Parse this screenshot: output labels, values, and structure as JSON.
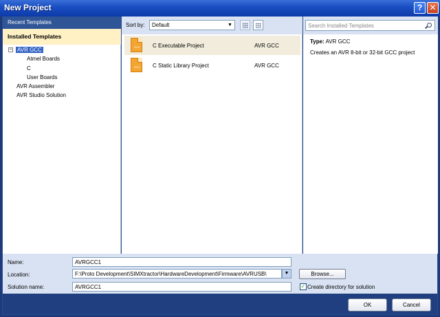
{
  "window": {
    "title": "New Project"
  },
  "left_panel": {
    "recent_label": "Recent Templates",
    "installed_label": "Installed Templates",
    "tree": [
      "AVR GCC",
      "Atmel Boards",
      "C",
      "User Boards",
      "AVR Assembler",
      "AVR Studio Solution"
    ]
  },
  "toolbar": {
    "sort_label": "Sort by:",
    "sort_value": "Default",
    "search_placeholder": "Search Installed Templates"
  },
  "templates": [
    {
      "icon_label": "GCC",
      "name": "C Executable Project",
      "type": "AVR GCC"
    },
    {
      "icon_label": "GCC",
      "name": "C Static Library Project",
      "type": "AVR GCC"
    }
  ],
  "details": {
    "type_label": "Type:",
    "type_value": "AVR GCC",
    "description": "Creates an AVR 8-bit or 32-bit GCC project"
  },
  "form": {
    "name_label": "Name:",
    "name_value": "AVRGCC1",
    "location_label": "Location:",
    "location_value": "F:\\Proto Development\\SIMXtractor\\HardwareDevelopment\\Firmware\\AVRUSB\\",
    "browse_label": "Browse...",
    "solution_label": "Solution name:",
    "solution_value": "AVRGCC1",
    "create_dir_label": "Create directory for solution",
    "create_dir_checked": "✓"
  },
  "buttons": {
    "ok": "OK",
    "cancel": "Cancel"
  },
  "icons": {
    "help": "help-icon",
    "close": "close-icon",
    "search": "search-icon",
    "dropdown": "chevron-down-icon",
    "expander": "collapse-icon"
  }
}
